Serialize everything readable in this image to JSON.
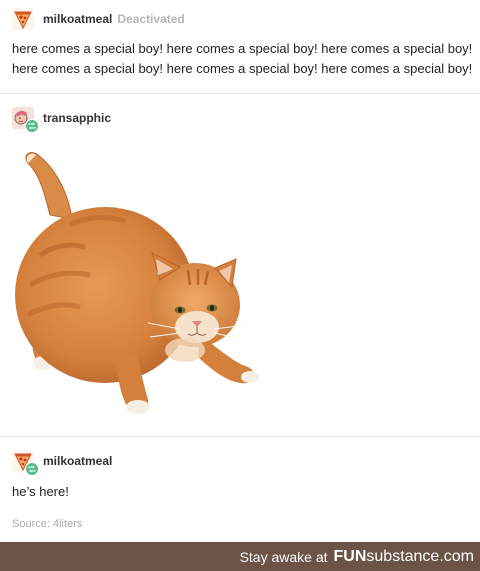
{
  "post1": {
    "username": "milkoatmeal",
    "status": "Deactivated",
    "text_line1": "here comes a special boy! here comes a special boy! here comes a special boy!",
    "text_line2": "here comes a special boy! here comes a special boy! here comes a special boy!"
  },
  "post2": {
    "username": "transapphic"
  },
  "post3": {
    "username": "milkoatmeal",
    "text": "he’s here!",
    "source": "Source: 4liters"
  },
  "footer": {
    "stay": "Stay awake at",
    "brand_bold": "FUN",
    "brand_rest": "substance.com"
  },
  "icons": {
    "pizza": "pizza-slice-icon",
    "reblog": "reblog-icon",
    "avatar_art": "cartoon-avatar-icon"
  },
  "colors": {
    "reblog": "#56bc8a",
    "footer_bg": "#6b5446"
  }
}
